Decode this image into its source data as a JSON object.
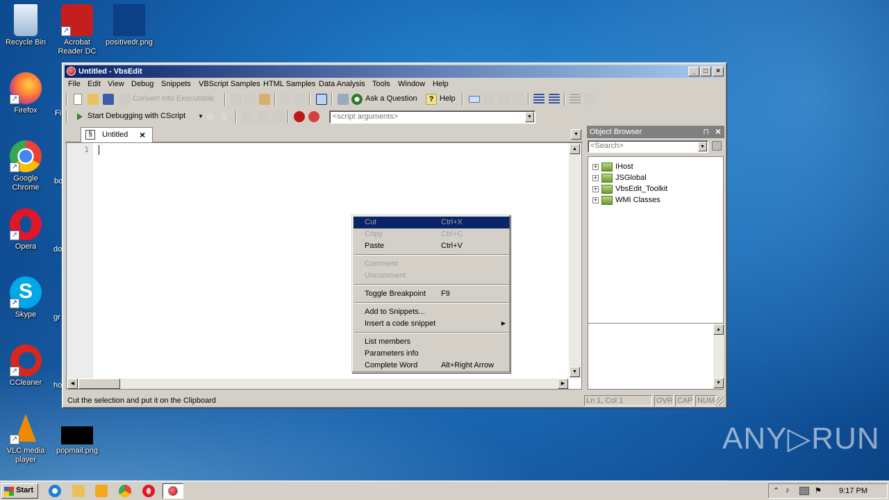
{
  "desktop": {
    "icons": [
      {
        "label": "Recycle Bin"
      },
      {
        "label": "Acrobat Reader DC"
      },
      {
        "label": "positivedr.png"
      },
      {
        "label": "Firefox"
      },
      {
        "label": "Google Chrome"
      },
      {
        "label": "Opera"
      },
      {
        "label": "Skype"
      },
      {
        "label": "CCleaner"
      },
      {
        "label": "VLC media player"
      },
      {
        "label": "popmail.png"
      }
    ],
    "partial_labels": [
      "Fi",
      "bo",
      "do",
      "gr",
      "ho"
    ],
    "watermark": "ANY▷RUN"
  },
  "window": {
    "title": "Untitled - VbsEdit",
    "controls": {
      "minimize": "_",
      "maximize": "□",
      "close": "×"
    },
    "menu": [
      "File",
      "Edit",
      "View",
      "Debug",
      "Snippets",
      "VBScript Samples",
      "HTML Samples",
      "Data Analysis",
      "Tools",
      "Window",
      "Help"
    ],
    "toolbar1": {
      "convert": "Convert Into Executable",
      "ask": "Ask a Question",
      "help": "Help"
    },
    "toolbar2": {
      "debug": "Start Debugging with CScript",
      "args_placeholder": "<script arguments>"
    },
    "tab": {
      "label": "Untitled",
      "close": "×"
    },
    "editor": {
      "line_number": "1"
    },
    "object_browser": {
      "title": "Object Browser",
      "pin": "⊓",
      "close": "×",
      "search_placeholder": "<Search>",
      "items": [
        "IHost",
        "JSGlobal",
        "VbsEdit_Toolkit",
        "WMI Classes"
      ]
    },
    "status": {
      "message": "Cut the selection and put it on the Clipboard",
      "position": "Ln 1, Col 1",
      "ovr": "OVR",
      "cap": "CAP",
      "num": "NUM"
    }
  },
  "context_menu": {
    "items": [
      {
        "label": "Cut",
        "shortcut": "Ctrl+X"
      },
      {
        "label": "Copy",
        "shortcut": "Ctrl+C"
      },
      {
        "label": "Paste",
        "shortcut": "Ctrl+V"
      },
      {
        "label": "Comment",
        "shortcut": ""
      },
      {
        "label": "Uncomment",
        "shortcut": ""
      },
      {
        "label": "Toggle Breakpoint",
        "shortcut": "F9"
      },
      {
        "label": "Add to Snippets...",
        "shortcut": ""
      },
      {
        "label": "Insert a code snippet",
        "shortcut": "▶"
      },
      {
        "label": "List members",
        "shortcut": ""
      },
      {
        "label": "Parameters info",
        "shortcut": ""
      },
      {
        "label": "Complete Word",
        "shortcut": "Alt+Right Arrow"
      }
    ]
  },
  "taskbar": {
    "start": "Start",
    "clock": "9:17 PM"
  },
  "colors": {
    "selection": "#0a246a",
    "title_start": "#0a246a",
    "title_end": "#a6caf0",
    "desktop": "#1a6cb8"
  }
}
